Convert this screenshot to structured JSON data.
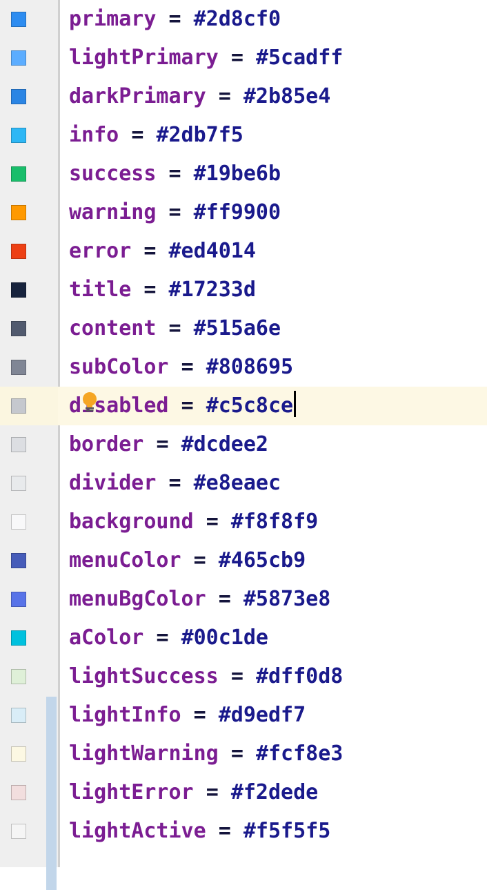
{
  "editor": {
    "name": "code-editor",
    "background": "#ffffff",
    "gutter_background": "#efefef",
    "gutter_separator_color": "#d0d0d0",
    "current_line_highlight": "#fdf8e4",
    "change_marker_color": "#c2d6ea",
    "syntax": {
      "property_color": "#7b1d92",
      "operator_color": "#14143c",
      "value_color": "#1a1a8c"
    },
    "operator": "=",
    "caret_visible": true,
    "caret_line_index": 11,
    "lightbulb_icon": "lightbulb-intention-icon",
    "lightbulb_line_index": 10,
    "change_marker_first_line": 18,
    "change_marker_last_line": 22
  },
  "lines": [
    {
      "property": "primary",
      "value": "#2d8cf0",
      "swatch": "#2d8cf0",
      "current": false
    },
    {
      "property": "lightPrimary",
      "value": "#5cadff",
      "swatch": "#5cadff",
      "current": false
    },
    {
      "property": "darkPrimary",
      "value": "#2b85e4",
      "swatch": "#2b85e4",
      "current": false
    },
    {
      "property": "info",
      "value": "#2db7f5",
      "swatch": "#2db7f5",
      "current": false
    },
    {
      "property": "success",
      "value": "#19be6b",
      "swatch": "#19be6b",
      "current": false
    },
    {
      "property": "warning",
      "value": "#ff9900",
      "swatch": "#ff9900",
      "current": false
    },
    {
      "property": "error",
      "value": "#ed4014",
      "swatch": "#ed4014",
      "current": false
    },
    {
      "property": "title",
      "value": "#17233d",
      "swatch": "#17233d",
      "current": false
    },
    {
      "property": "content",
      "value": "#515a6e",
      "swatch": "#515a6e",
      "current": false
    },
    {
      "property": "subColor",
      "value": "#808695",
      "swatch": "#808695",
      "current": false
    },
    {
      "property": "disabled",
      "value": "#c5c8ce",
      "swatch": "#c5c8ce",
      "current": true
    },
    {
      "property": "border",
      "value": "#dcdee2",
      "swatch": "#dcdee2",
      "current": false
    },
    {
      "property": "divider",
      "value": "#e8eaec",
      "swatch": "#e8eaec",
      "current": false
    },
    {
      "property": "background",
      "value": "#f8f8f9",
      "swatch": "#f8f8f9",
      "current": false
    },
    {
      "property": "menuColor",
      "value": "#465cb9",
      "swatch": "#465cb9",
      "current": false
    },
    {
      "property": "menuBgColor",
      "value": "#5873e8",
      "swatch": "#5873e8",
      "current": false
    },
    {
      "property": "aColor",
      "value": "#00c1de",
      "swatch": "#00c1de",
      "current": false
    },
    {
      "property": "lightSuccess",
      "value": "#dff0d8",
      "swatch": "#dff0d8",
      "current": false
    },
    {
      "property": "lightInfo",
      "value": "#d9edf7",
      "swatch": "#d9edf7",
      "current": false
    },
    {
      "property": "lightWarning",
      "value": "#fcf8e3",
      "swatch": "#fcf8e3",
      "current": false
    },
    {
      "property": "lightError",
      "value": "#f2dede",
      "swatch": "#f2dede",
      "current": false
    },
    {
      "property": "lightActive",
      "value": "#f5f5f5",
      "swatch": "#f5f5f5",
      "current": false
    }
  ]
}
